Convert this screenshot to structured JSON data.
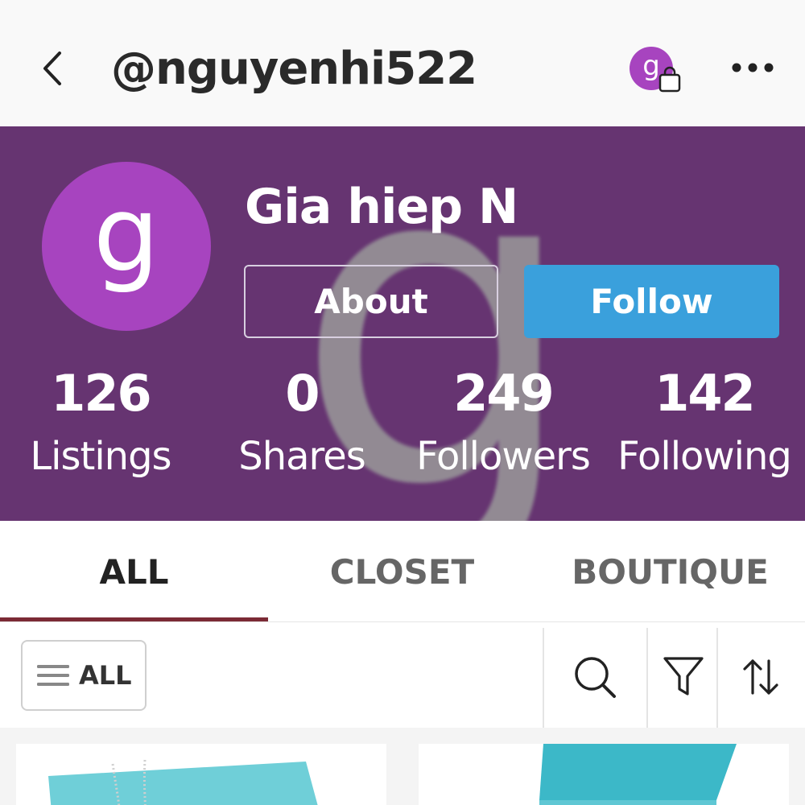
{
  "header": {
    "username": "@nguyenhi522",
    "mini_avatar_letter": "g"
  },
  "profile": {
    "avatar_letter": "g",
    "display_name": "Gia hiep N",
    "about_label": "About",
    "follow_label": "Follow",
    "banner_color": "#663471",
    "avatar_color": "#a744bf",
    "follow_color": "#3aa0dc"
  },
  "stats": [
    {
      "value": "126",
      "label": "Listings"
    },
    {
      "value": "0",
      "label": "Shares"
    },
    {
      "value": "249",
      "label": "Followers"
    },
    {
      "value": "142",
      "label": "Following"
    }
  ],
  "tabs": [
    {
      "label": "ALL",
      "active": true
    },
    {
      "label": "CLOSET",
      "active": false
    },
    {
      "label": "BOUTIQUE",
      "active": false
    }
  ],
  "filter": {
    "all_label": "ALL"
  },
  "icons": {
    "back": "chevron-left-icon",
    "bag": "shopping-bag-icon",
    "more": "more-dots-icon",
    "menu": "hamburger-icon",
    "search": "search-icon",
    "filter": "filter-icon",
    "sort": "sort-icon"
  }
}
